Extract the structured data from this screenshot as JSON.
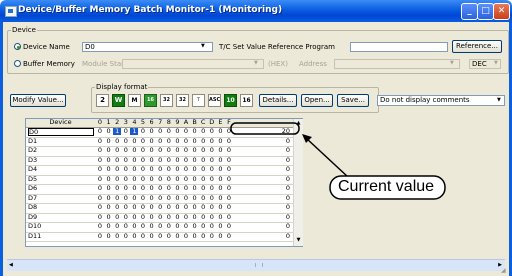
{
  "window": {
    "title": "Device/Buffer Memory Batch Monitor-1 (Monitoring)"
  },
  "device_group": {
    "label": "Device",
    "device_name_label": "Device Name",
    "device_name_value": "D0",
    "tc_label": "T/C Set Value Reference Program",
    "reference_button": "Reference...",
    "buffer_memory_label": "Buffer Memory",
    "module_start_label": "Module Start",
    "hex_label": "(HEX)",
    "address_label": "Address",
    "dec_value": "DEC"
  },
  "toolbar": {
    "modify_value_button": "Modify Value...",
    "display_format_label": "Display format",
    "format_buttons": [
      "2",
      "W",
      "M",
      "16",
      "32",
      "32",
      "T",
      "ASC",
      "10",
      "16"
    ],
    "details_button": "Details...",
    "open_button": "Open...",
    "save_button": "Save...",
    "comment_select": "Do not display comments"
  },
  "table": {
    "device_header": "Device",
    "bit_headers": [
      "0",
      "1",
      "2",
      "3",
      "4",
      "5",
      "6",
      "7",
      "8",
      "9",
      "A",
      "B",
      "C",
      "D",
      "E",
      "F"
    ],
    "rows": [
      {
        "device": "D0",
        "bits": [
          "0",
          "0",
          "1",
          "0",
          "1",
          "0",
          "0",
          "0",
          "0",
          "0",
          "0",
          "0",
          "0",
          "0",
          "0",
          "0"
        ],
        "value": "20"
      },
      {
        "device": "D1",
        "bits": [
          "0",
          "0",
          "0",
          "0",
          "0",
          "0",
          "0",
          "0",
          "0",
          "0",
          "0",
          "0",
          "0",
          "0",
          "0",
          "0"
        ],
        "value": "0"
      },
      {
        "device": "D2",
        "bits": [
          "0",
          "0",
          "0",
          "0",
          "0",
          "0",
          "0",
          "0",
          "0",
          "0",
          "0",
          "0",
          "0",
          "0",
          "0",
          "0"
        ],
        "value": "0"
      },
      {
        "device": "D3",
        "bits": [
          "0",
          "0",
          "0",
          "0",
          "0",
          "0",
          "0",
          "0",
          "0",
          "0",
          "0",
          "0",
          "0",
          "0",
          "0",
          "0"
        ],
        "value": "0"
      },
      {
        "device": "D4",
        "bits": [
          "0",
          "0",
          "0",
          "0",
          "0",
          "0",
          "0",
          "0",
          "0",
          "0",
          "0",
          "0",
          "0",
          "0",
          "0",
          "0"
        ],
        "value": "0"
      },
      {
        "device": "D5",
        "bits": [
          "0",
          "0",
          "0",
          "0",
          "0",
          "0",
          "0",
          "0",
          "0",
          "0",
          "0",
          "0",
          "0",
          "0",
          "0",
          "0"
        ],
        "value": "0"
      },
      {
        "device": "D6",
        "bits": [
          "0",
          "0",
          "0",
          "0",
          "0",
          "0",
          "0",
          "0",
          "0",
          "0",
          "0",
          "0",
          "0",
          "0",
          "0",
          "0"
        ],
        "value": "0"
      },
      {
        "device": "D7",
        "bits": [
          "0",
          "0",
          "0",
          "0",
          "0",
          "0",
          "0",
          "0",
          "0",
          "0",
          "0",
          "0",
          "0",
          "0",
          "0",
          "0"
        ],
        "value": "0"
      },
      {
        "device": "D8",
        "bits": [
          "0",
          "0",
          "0",
          "0",
          "0",
          "0",
          "0",
          "0",
          "0",
          "0",
          "0",
          "0",
          "0",
          "0",
          "0",
          "0"
        ],
        "value": "0"
      },
      {
        "device": "D9",
        "bits": [
          "0",
          "0",
          "0",
          "0",
          "0",
          "0",
          "0",
          "0",
          "0",
          "0",
          "0",
          "0",
          "0",
          "0",
          "0",
          "0"
        ],
        "value": "0"
      },
      {
        "device": "D10",
        "bits": [
          "0",
          "0",
          "0",
          "0",
          "0",
          "0",
          "0",
          "0",
          "0",
          "0",
          "0",
          "0",
          "0",
          "0",
          "0",
          "0"
        ],
        "value": "0"
      },
      {
        "device": "D11",
        "bits": [
          "0",
          "0",
          "0",
          "0",
          "0",
          "0",
          "0",
          "0",
          "0",
          "0",
          "0",
          "0",
          "0",
          "0",
          "0",
          "0"
        ],
        "value": "0"
      }
    ]
  },
  "callout": {
    "text": "Current value"
  }
}
